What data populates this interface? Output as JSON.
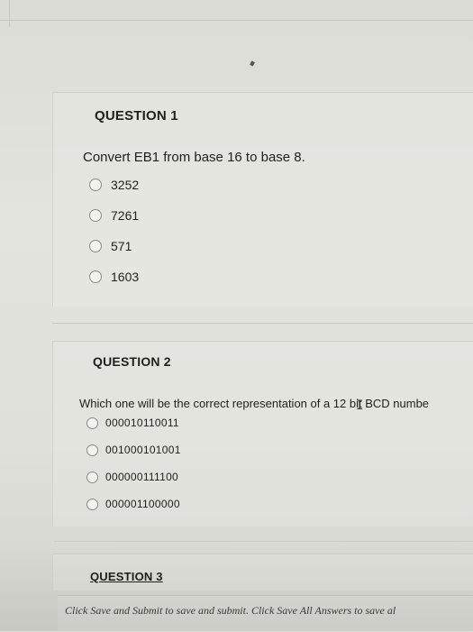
{
  "questions": [
    {
      "title": "QUESTION 1",
      "prompt": "Convert EB1 from base 16 to base 8.",
      "options": [
        "3252",
        "7261",
        "571",
        "1603"
      ]
    },
    {
      "title": "QUESTION 2",
      "prompt": "Which one will be the correct representation of a 12 bit BCD numbe",
      "options": [
        "000010110011",
        "001000101001",
        "000000111100",
        "000001100000"
      ]
    },
    {
      "title": "QUESTION 3"
    }
  ],
  "footer": {
    "instruction": "Click Save and Submit to save and submit. Click Save All Answers to save al"
  },
  "icons": {
    "cursor": "text-cursor-icon"
  }
}
